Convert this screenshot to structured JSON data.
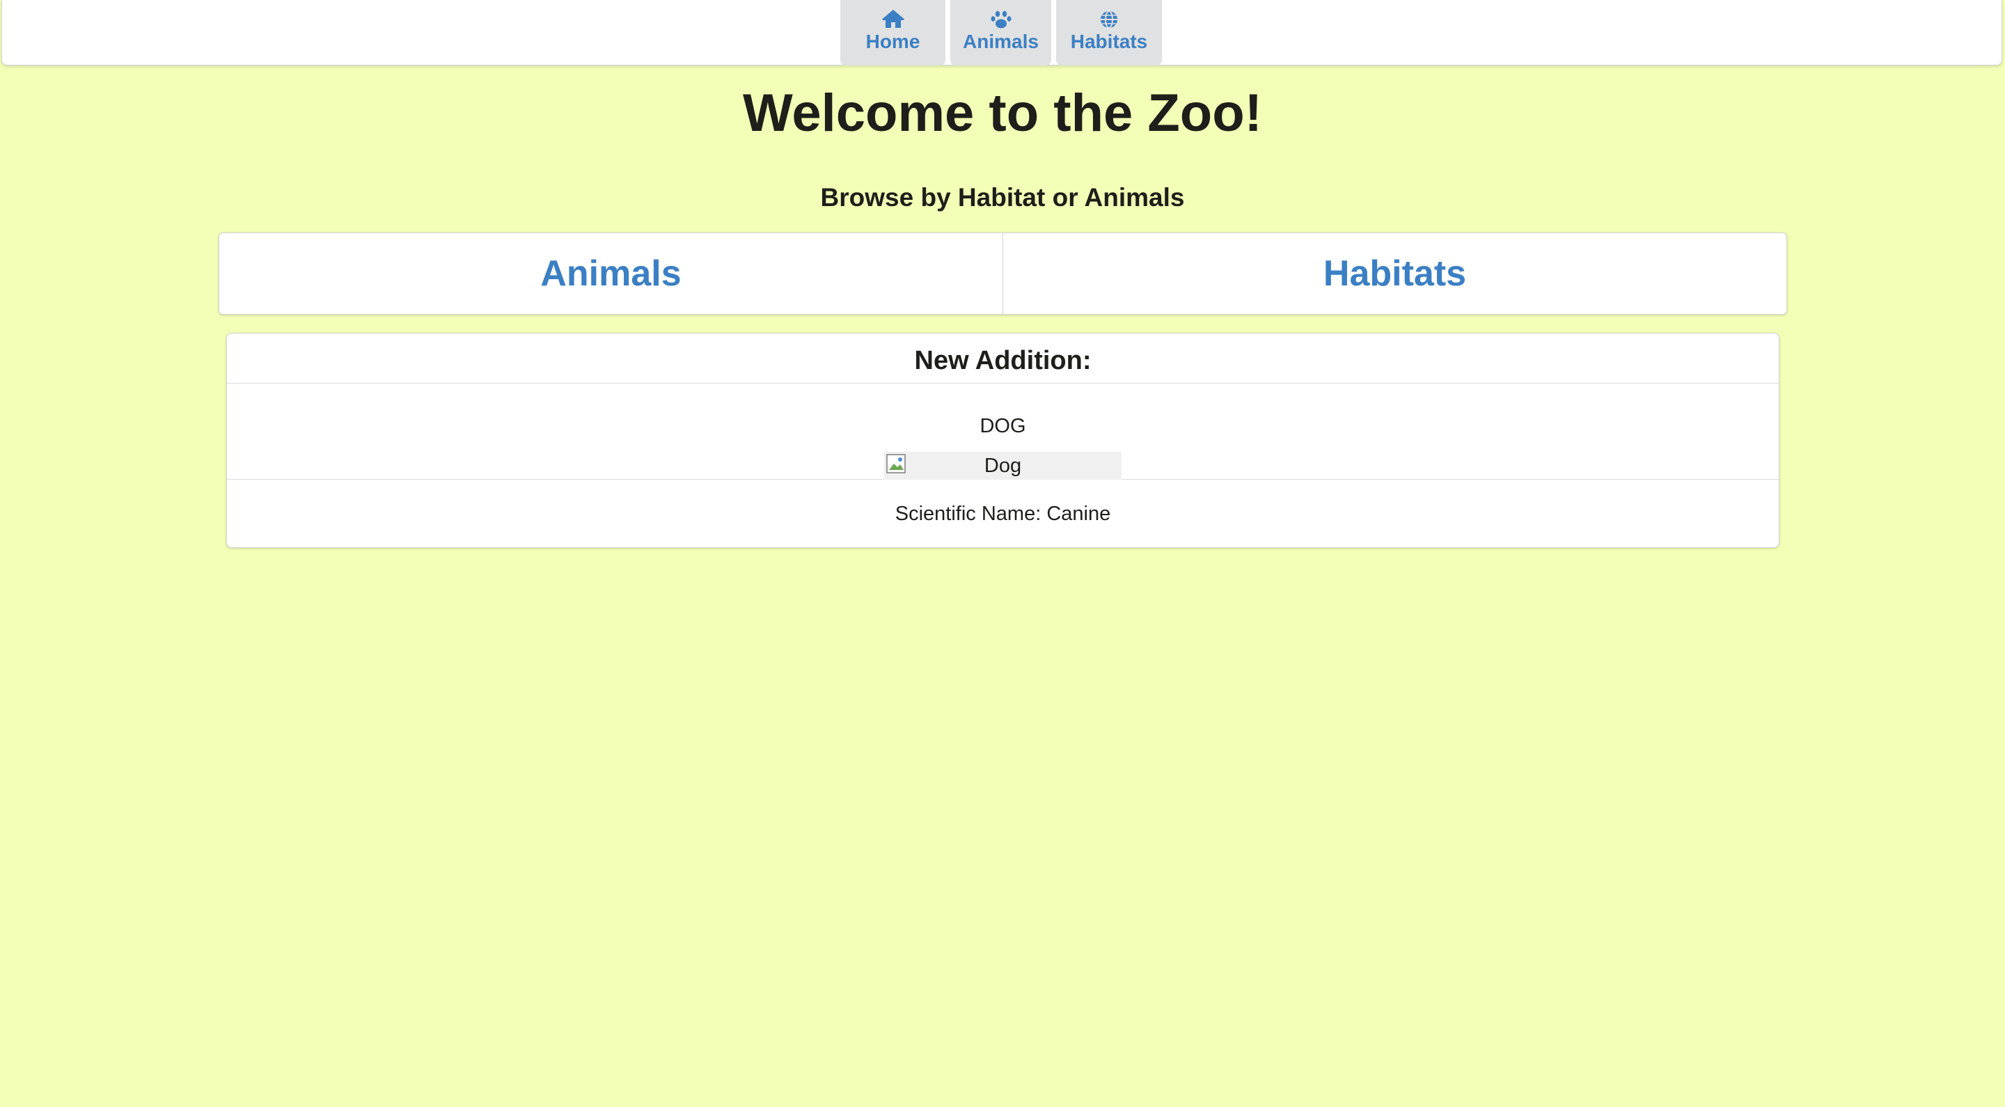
{
  "nav": {
    "items": [
      {
        "label": "Home",
        "icon": "home-icon"
      },
      {
        "label": "Animals",
        "icon": "paw-icon"
      },
      {
        "label": "Habitats",
        "icon": "globe-icon"
      }
    ]
  },
  "page": {
    "title": "Welcome to the Zoo!",
    "subtitle": "Browse by Habitat or Animals"
  },
  "browse": {
    "animals_label": "Animals",
    "habitats_label": "Habitats"
  },
  "featured": {
    "header": "New Addition:",
    "name": "DOG",
    "image_alt": "Dog",
    "scientific_name": "Scientific Name: Canine"
  },
  "colors": {
    "background": "#f3ffb6",
    "link": "#3b7fc4",
    "menu_item_bg": "#e0e1e2"
  }
}
